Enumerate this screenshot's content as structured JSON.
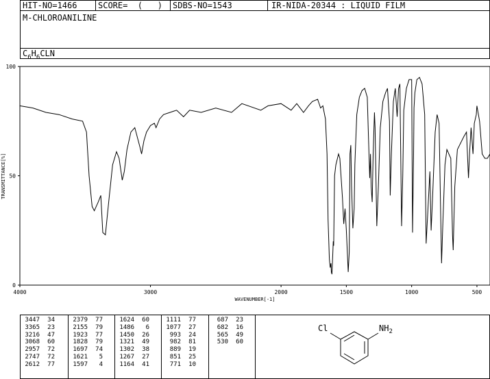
{
  "header": {
    "hit_no": "HIT-NO=1466",
    "score": "SCORE=  (   )",
    "sdbs_no": "SDBS-NO=1543",
    "ir_info": "IR-NIDA-20344 : LIQUID FILM",
    "compound_name": "M-CHLOROANILINE",
    "formula_main": "C",
    "formula_sub1": "6",
    "formula_mid": "H",
    "formula_sub2": "6",
    "formula_tail": "CLN"
  },
  "chart_data": {
    "type": "line",
    "xlabel": "WAVENUMBER[-1]",
    "ylabel": "TRANSMITTANCE[%]",
    "xlim": [
      4000,
      400
    ],
    "ylim": [
      0,
      100
    ],
    "x_ticks": [
      4000,
      3000,
      2000,
      1500,
      1000,
      500
    ],
    "y_ticks": [
      0,
      50,
      100
    ],
    "x_tick_labels": [
      "4000",
      "3000",
      "2000",
      "1500",
      "1000",
      "500"
    ],
    "y_tick_labels": [
      "0",
      "50",
      "100"
    ],
    "series": [
      {
        "points": [
          [
            4000,
            82
          ],
          [
            3900,
            81
          ],
          [
            3800,
            79
          ],
          [
            3700,
            78
          ],
          [
            3600,
            76
          ],
          [
            3520,
            75
          ],
          [
            3490,
            70
          ],
          [
            3470,
            50
          ],
          [
            3447,
            36
          ],
          [
            3430,
            34
          ],
          [
            3400,
            38
          ],
          [
            3380,
            41
          ],
          [
            3365,
            24
          ],
          [
            3345,
            23
          ],
          [
            3320,
            38
          ],
          [
            3290,
            55
          ],
          [
            3260,
            61
          ],
          [
            3240,
            58
          ],
          [
            3216,
            48
          ],
          [
            3200,
            52
          ],
          [
            3180,
            62
          ],
          [
            3150,
            70
          ],
          [
            3120,
            72
          ],
          [
            3080,
            63
          ],
          [
            3068,
            60
          ],
          [
            3050,
            66
          ],
          [
            3030,
            70
          ],
          [
            3000,
            73
          ],
          [
            2970,
            74
          ],
          [
            2957,
            72
          ],
          [
            2930,
            76
          ],
          [
            2900,
            78
          ],
          [
            2850,
            79
          ],
          [
            2800,
            80
          ],
          [
            2747,
            77
          ],
          [
            2700,
            80
          ],
          [
            2612,
            79
          ],
          [
            2500,
            81
          ],
          [
            2379,
            79
          ],
          [
            2300,
            83
          ],
          [
            2155,
            80
          ],
          [
            2100,
            82
          ],
          [
            2000,
            83
          ],
          [
            1923,
            80
          ],
          [
            1880,
            83
          ],
          [
            1828,
            79
          ],
          [
            1790,
            82
          ],
          [
            1760,
            84
          ],
          [
            1720,
            85
          ],
          [
            1697,
            81
          ],
          [
            1680,
            82
          ],
          [
            1660,
            76
          ],
          [
            1648,
            60
          ],
          [
            1640,
            30
          ],
          [
            1630,
            12
          ],
          [
            1624,
            8
          ],
          [
            1618,
            10
          ],
          [
            1615,
            6
          ],
          [
            1610,
            5
          ],
          [
            1600,
            20
          ],
          [
            1597,
            18
          ],
          [
            1590,
            50
          ],
          [
            1580,
            55
          ],
          [
            1560,
            60
          ],
          [
            1550,
            58
          ],
          [
            1530,
            40
          ],
          [
            1520,
            28
          ],
          [
            1510,
            35
          ],
          [
            1500,
            25
          ],
          [
            1486,
            6
          ],
          [
            1478,
            15
          ],
          [
            1472,
            60
          ],
          [
            1466,
            64
          ],
          [
            1460,
            45
          ],
          [
            1450,
            26
          ],
          [
            1440,
            35
          ],
          [
            1435,
            55
          ],
          [
            1420,
            78
          ],
          [
            1400,
            86
          ],
          [
            1380,
            89
          ],
          [
            1360,
            90
          ],
          [
            1340,
            86
          ],
          [
            1321,
            49
          ],
          [
            1315,
            60
          ],
          [
            1310,
            45
          ],
          [
            1302,
            38
          ],
          [
            1295,
            60
          ],
          [
            1285,
            79
          ],
          [
            1280,
            72
          ],
          [
            1267,
            27
          ],
          [
            1255,
            45
          ],
          [
            1240,
            72
          ],
          [
            1220,
            84
          ],
          [
            1200,
            88
          ],
          [
            1185,
            90
          ],
          [
            1170,
            75
          ],
          [
            1164,
            41
          ],
          [
            1155,
            60
          ],
          [
            1140,
            84
          ],
          [
            1125,
            90
          ],
          [
            1111,
            77
          ],
          [
            1100,
            90
          ],
          [
            1090,
            92
          ],
          [
            1077,
            27
          ],
          [
            1068,
            50
          ],
          [
            1060,
            80
          ],
          [
            1040,
            90
          ],
          [
            1020,
            94
          ],
          [
            1000,
            94
          ],
          [
            993,
            24
          ],
          [
            985,
            60
          ],
          [
            982,
            81
          ],
          [
            975,
            88
          ],
          [
            960,
            94
          ],
          [
            940,
            95
          ],
          [
            920,
            92
          ],
          [
            900,
            78
          ],
          [
            889,
            19
          ],
          [
            875,
            35
          ],
          [
            860,
            52
          ],
          [
            851,
            25
          ],
          [
            840,
            40
          ],
          [
            820,
            70
          ],
          [
            805,
            78
          ],
          [
            790,
            74
          ],
          [
            771,
            10
          ],
          [
            760,
            30
          ],
          [
            745,
            55
          ],
          [
            730,
            62
          ],
          [
            700,
            58
          ],
          [
            687,
            23
          ],
          [
            682,
            16
          ],
          [
            670,
            45
          ],
          [
            650,
            62
          ],
          [
            600,
            68
          ],
          [
            580,
            70
          ],
          [
            565,
            49
          ],
          [
            555,
            62
          ],
          [
            545,
            72
          ],
          [
            530,
            60
          ],
          [
            520,
            74
          ],
          [
            505,
            78
          ],
          [
            500,
            82
          ],
          [
            480,
            75
          ],
          [
            460,
            60
          ],
          [
            440,
            58
          ],
          [
            420,
            58
          ],
          [
            400,
            60
          ]
        ]
      }
    ]
  },
  "peak_table": {
    "columns": [
      [
        [
          "3447",
          "34"
        ],
        [
          "3365",
          "23"
        ],
        [
          "3216",
          "47"
        ],
        [
          "3068",
          "60"
        ],
        [
          "2957",
          "72"
        ],
        [
          "2747",
          "72"
        ],
        [
          "2612",
          "77"
        ]
      ],
      [
        [
          "2379",
          "77"
        ],
        [
          "2155",
          "79"
        ],
        [
          "1923",
          "77"
        ],
        [
          "1828",
          "79"
        ],
        [
          "1697",
          "74"
        ],
        [
          "1621",
          "5"
        ],
        [
          "1597",
          "4"
        ]
      ],
      [
        [
          "1624",
          "60"
        ],
        [
          "1486",
          "6"
        ],
        [
          "1450",
          "26"
        ],
        [
          "1321",
          "49"
        ],
        [
          "1302",
          "38"
        ],
        [
          "1267",
          "27"
        ],
        [
          "1164",
          "41"
        ]
      ],
      [
        [
          "1111",
          "77"
        ],
        [
          "1077",
          "27"
        ],
        [
          "993",
          "24"
        ],
        [
          "982",
          "81"
        ],
        [
          "889",
          "19"
        ],
        [
          "851",
          "25"
        ],
        [
          "771",
          "10"
        ]
      ],
      [
        [
          "687",
          "23"
        ],
        [
          "682",
          "16"
        ],
        [
          "565",
          "49"
        ],
        [
          "530",
          "60"
        ]
      ]
    ]
  },
  "structure": {
    "substituent_cl": "Cl",
    "substituent_nh": "NH",
    "substituent_nh_sub": "2"
  }
}
